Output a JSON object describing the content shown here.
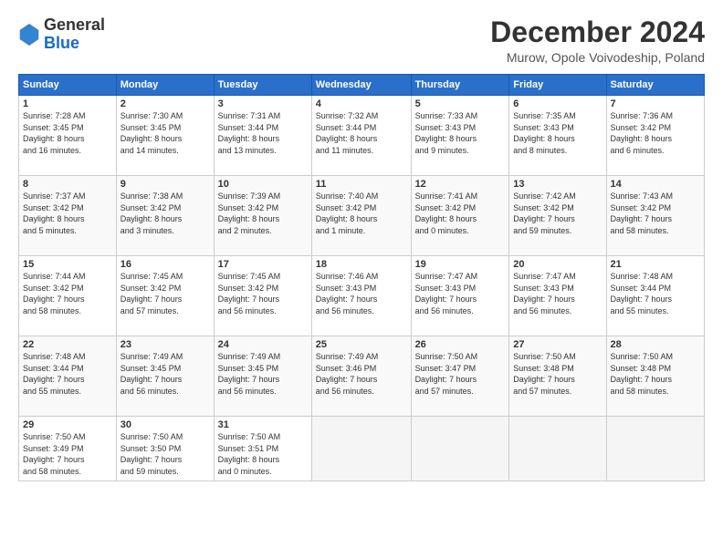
{
  "header": {
    "logo_general": "General",
    "logo_blue": "Blue",
    "month_title": "December 2024",
    "subtitle": "Murow, Opole Voivodeship, Poland"
  },
  "days_of_week": [
    "Sunday",
    "Monday",
    "Tuesday",
    "Wednesday",
    "Thursday",
    "Friday",
    "Saturday"
  ],
  "weeks": [
    [
      {
        "day": "1",
        "info": "Sunrise: 7:28 AM\nSunset: 3:45 PM\nDaylight: 8 hours\nand 16 minutes."
      },
      {
        "day": "2",
        "info": "Sunrise: 7:30 AM\nSunset: 3:45 PM\nDaylight: 8 hours\nand 14 minutes."
      },
      {
        "day": "3",
        "info": "Sunrise: 7:31 AM\nSunset: 3:44 PM\nDaylight: 8 hours\nand 13 minutes."
      },
      {
        "day": "4",
        "info": "Sunrise: 7:32 AM\nSunset: 3:44 PM\nDaylight: 8 hours\nand 11 minutes."
      },
      {
        "day": "5",
        "info": "Sunrise: 7:33 AM\nSunset: 3:43 PM\nDaylight: 8 hours\nand 9 minutes."
      },
      {
        "day": "6",
        "info": "Sunrise: 7:35 AM\nSunset: 3:43 PM\nDaylight: 8 hours\nand 8 minutes."
      },
      {
        "day": "7",
        "info": "Sunrise: 7:36 AM\nSunset: 3:42 PM\nDaylight: 8 hours\nand 6 minutes."
      }
    ],
    [
      {
        "day": "8",
        "info": "Sunrise: 7:37 AM\nSunset: 3:42 PM\nDaylight: 8 hours\nand 5 minutes."
      },
      {
        "day": "9",
        "info": "Sunrise: 7:38 AM\nSunset: 3:42 PM\nDaylight: 8 hours\nand 3 minutes."
      },
      {
        "day": "10",
        "info": "Sunrise: 7:39 AM\nSunset: 3:42 PM\nDaylight: 8 hours\nand 2 minutes."
      },
      {
        "day": "11",
        "info": "Sunrise: 7:40 AM\nSunset: 3:42 PM\nDaylight: 8 hours\nand 1 minute."
      },
      {
        "day": "12",
        "info": "Sunrise: 7:41 AM\nSunset: 3:42 PM\nDaylight: 8 hours\nand 0 minutes."
      },
      {
        "day": "13",
        "info": "Sunrise: 7:42 AM\nSunset: 3:42 PM\nDaylight: 7 hours\nand 59 minutes."
      },
      {
        "day": "14",
        "info": "Sunrise: 7:43 AM\nSunset: 3:42 PM\nDaylight: 7 hours\nand 58 minutes."
      }
    ],
    [
      {
        "day": "15",
        "info": "Sunrise: 7:44 AM\nSunset: 3:42 PM\nDaylight: 7 hours\nand 58 minutes."
      },
      {
        "day": "16",
        "info": "Sunrise: 7:45 AM\nSunset: 3:42 PM\nDaylight: 7 hours\nand 57 minutes."
      },
      {
        "day": "17",
        "info": "Sunrise: 7:45 AM\nSunset: 3:42 PM\nDaylight: 7 hours\nand 56 minutes."
      },
      {
        "day": "18",
        "info": "Sunrise: 7:46 AM\nSunset: 3:43 PM\nDaylight: 7 hours\nand 56 minutes."
      },
      {
        "day": "19",
        "info": "Sunrise: 7:47 AM\nSunset: 3:43 PM\nDaylight: 7 hours\nand 56 minutes."
      },
      {
        "day": "20",
        "info": "Sunrise: 7:47 AM\nSunset: 3:43 PM\nDaylight: 7 hours\nand 56 minutes."
      },
      {
        "day": "21",
        "info": "Sunrise: 7:48 AM\nSunset: 3:44 PM\nDaylight: 7 hours\nand 55 minutes."
      }
    ],
    [
      {
        "day": "22",
        "info": "Sunrise: 7:48 AM\nSunset: 3:44 PM\nDaylight: 7 hours\nand 55 minutes."
      },
      {
        "day": "23",
        "info": "Sunrise: 7:49 AM\nSunset: 3:45 PM\nDaylight: 7 hours\nand 56 minutes."
      },
      {
        "day": "24",
        "info": "Sunrise: 7:49 AM\nSunset: 3:45 PM\nDaylight: 7 hours\nand 56 minutes."
      },
      {
        "day": "25",
        "info": "Sunrise: 7:49 AM\nSunset: 3:46 PM\nDaylight: 7 hours\nand 56 minutes."
      },
      {
        "day": "26",
        "info": "Sunrise: 7:50 AM\nSunset: 3:47 PM\nDaylight: 7 hours\nand 57 minutes."
      },
      {
        "day": "27",
        "info": "Sunrise: 7:50 AM\nSunset: 3:48 PM\nDaylight: 7 hours\nand 57 minutes."
      },
      {
        "day": "28",
        "info": "Sunrise: 7:50 AM\nSunset: 3:48 PM\nDaylight: 7 hours\nand 58 minutes."
      }
    ],
    [
      {
        "day": "29",
        "info": "Sunrise: 7:50 AM\nSunset: 3:49 PM\nDaylight: 7 hours\nand 58 minutes."
      },
      {
        "day": "30",
        "info": "Sunrise: 7:50 AM\nSunset: 3:50 PM\nDaylight: 7 hours\nand 59 minutes."
      },
      {
        "day": "31",
        "info": "Sunrise: 7:50 AM\nSunset: 3:51 PM\nDaylight: 8 hours\nand 0 minutes."
      },
      {
        "day": "",
        "info": ""
      },
      {
        "day": "",
        "info": ""
      },
      {
        "day": "",
        "info": ""
      },
      {
        "day": "",
        "info": ""
      }
    ]
  ]
}
